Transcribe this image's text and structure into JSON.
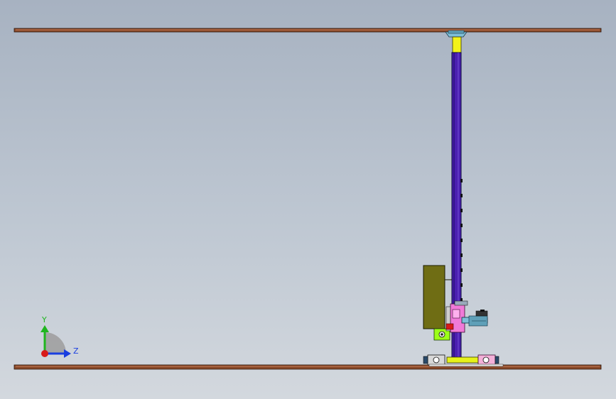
{
  "viewport": {
    "background_top": "#a7b2c1",
    "background_bottom": "#d3d8de"
  },
  "triad": {
    "y_label": "Y",
    "z_label": "Z",
    "y_color": "#1fb51f",
    "z_color": "#1a3fe0",
    "x_color": "#d81a1a"
  },
  "model": {
    "beam_color": "#8a4a2a",
    "beam_highlight": "#d58a6a",
    "column_color": "#4b1fb0",
    "column_edge": "#0a0a3a",
    "top_connector_color": "#f2f21a",
    "cabinet_color": "#6f6d14",
    "base_plate_color": "#e6f21a",
    "pink_part_color": "#f07ad8",
    "green_block_color": "#9cff1a"
  }
}
